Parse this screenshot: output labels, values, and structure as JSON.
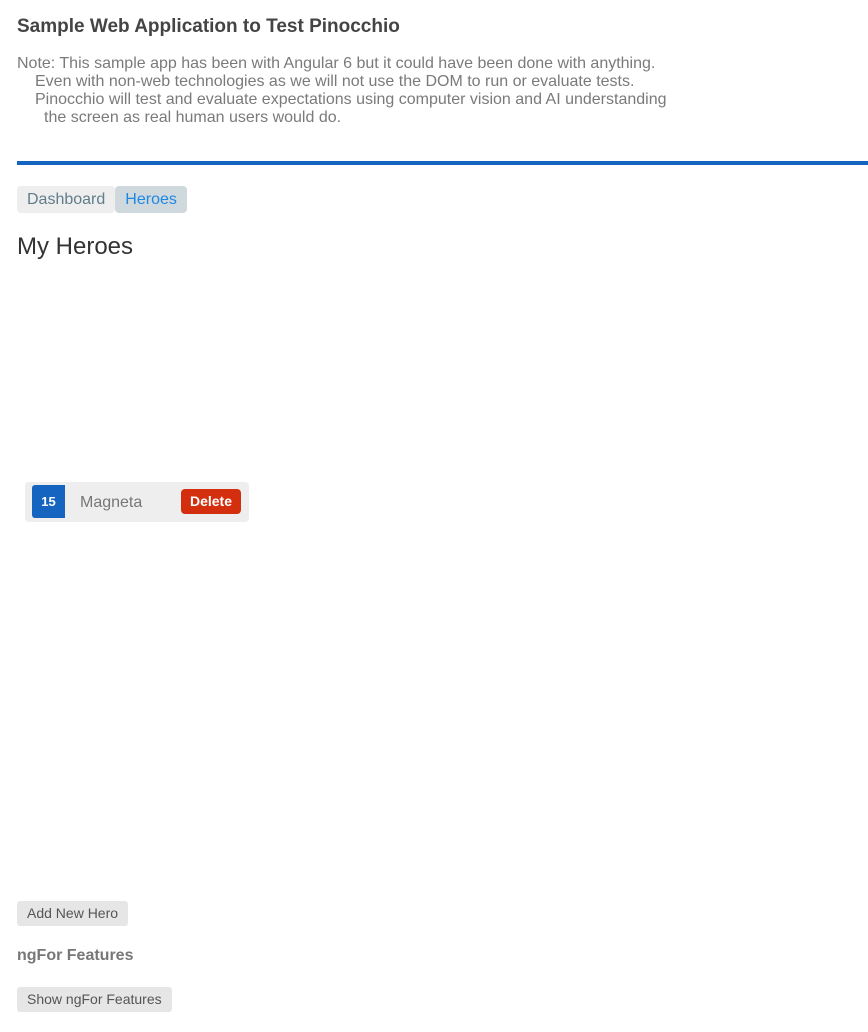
{
  "app": {
    "title": "Sample Web Application to Test Pinocchio",
    "note_lines": [
      "Note: This sample app has been with Angular 6 but it could have been done with anything.",
      "Even with non-web technologies as we will not use the DOM to run or evaluate tests.",
      "Pinocchio will test and evaluate expectations using computer vision and AI understanding",
      "the screen as real human users would do."
    ]
  },
  "nav": {
    "items": [
      {
        "label": "Dashboard",
        "active": false
      },
      {
        "label": "Heroes",
        "active": true
      }
    ]
  },
  "heroes": {
    "heading": "My Heroes",
    "list": [
      {
        "id": "15",
        "name": "Magneta",
        "delete_label": "Delete"
      }
    ],
    "add_label": "Add New Hero"
  },
  "ngfor": {
    "title": "ngFor Features",
    "button_label": "Show ngFor Features"
  },
  "colors": {
    "accent": "#1565c0",
    "delete": "#d32f0f",
    "active_link": "#1e88e5"
  }
}
